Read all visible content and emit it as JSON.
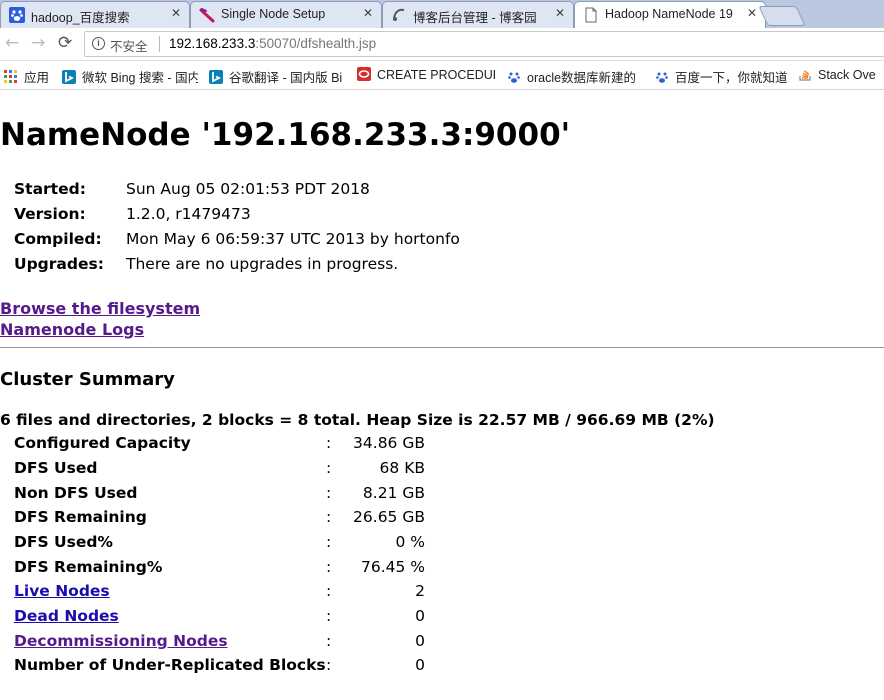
{
  "browser": {
    "tabs": [
      {
        "title": "hadoop_百度搜索",
        "icon": "baidu-icon",
        "active": false
      },
      {
        "title": "Single Node Setup",
        "icon": "feather-icon",
        "active": false
      },
      {
        "title": "博客后台管理 - 博客园",
        "icon": "cnblogs-icon",
        "active": false
      },
      {
        "title": "Hadoop NameNode 19",
        "icon": "page-icon",
        "active": true
      }
    ],
    "tab_close": "✕",
    "security_label": "不安全",
    "url_host": "192.168.233.3",
    "url_rest": ":50070/dfshealth.jsp",
    "bookmarks": [
      {
        "label": "应用",
        "icon": "apps-grid-icon"
      },
      {
        "label": "微软 Bing 搜索 - 国内",
        "icon": "bing-icon"
      },
      {
        "label": "谷歌翻译 - 国内版 Bi",
        "icon": "bing-icon"
      },
      {
        "label": "CREATE PROCEDUR",
        "icon": "oracle-icon"
      },
      {
        "label": "oracle数据库新建的",
        "icon": "baidu-icon"
      },
      {
        "label": "百度一下，你就知道",
        "icon": "baidu-icon"
      },
      {
        "label": "Stack Ove",
        "icon": "stackoverflow-icon"
      }
    ]
  },
  "page": {
    "title": "NameNode '192.168.233.3:9000'",
    "info": [
      {
        "key": "Started:",
        "value": "Sun Aug 05 02:01:53 PDT 2018"
      },
      {
        "key": "Version:",
        "value": "1.2.0, r1479473"
      },
      {
        "key": "Compiled:",
        "value": "Mon May  6 06:59:37 UTC 2013 by hortonfo"
      },
      {
        "key": "Upgrades:",
        "value": "There are no upgrades in progress."
      }
    ],
    "links": {
      "browse": "Browse the filesystem",
      "logs": "Namenode Logs"
    },
    "cluster_summary_title": "Cluster Summary",
    "totals_line": "6 files and directories, 2 blocks = 8 total. Heap Size is 22.57 MB / 966.69 MB (2%)",
    "separator": ":",
    "summary": [
      {
        "key": "Configured Capacity",
        "value": "34.86 GB",
        "link": false
      },
      {
        "key": "DFS Used",
        "value": "68 KB",
        "link": false
      },
      {
        "key": "Non DFS Used",
        "value": "8.21 GB",
        "link": false
      },
      {
        "key": "DFS Remaining",
        "value": "26.65 GB",
        "link": false
      },
      {
        "key": "DFS Used%",
        "value": "0 %",
        "link": false
      },
      {
        "key": "DFS Remaining%",
        "value": "76.45 %",
        "link": false
      },
      {
        "key": "Live Nodes",
        "value": "2",
        "link": true
      },
      {
        "key": "Dead Nodes",
        "value": "0",
        "link": true
      },
      {
        "key": "Decommissioning Nodes",
        "value": "0",
        "link": true
      },
      {
        "key": "Number of Under-Replicated Blocks",
        "value": "0",
        "link": false
      }
    ]
  },
  "colors": {
    "link": "#1a0dab",
    "visited_link": "#551a8b",
    "tabstrip": "#b9c7df"
  }
}
